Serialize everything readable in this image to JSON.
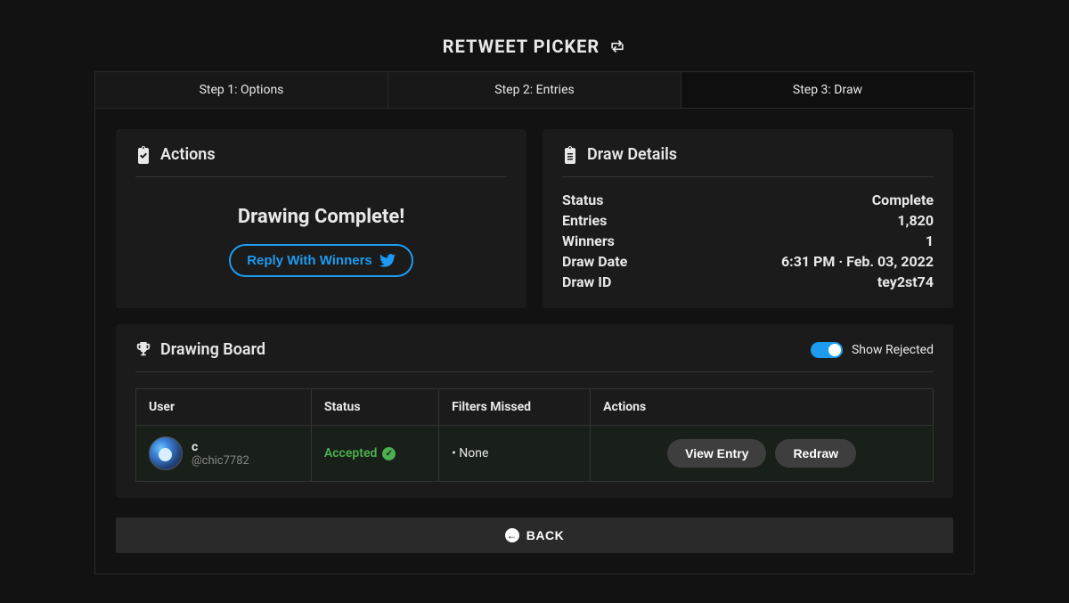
{
  "pageTitle": "RETWEET PICKER",
  "tabs": [
    {
      "label": "Step 1: Options"
    },
    {
      "label": "Step 2: Entries"
    },
    {
      "label": "Step 3: Draw"
    }
  ],
  "actions": {
    "title": "Actions",
    "completeText": "Drawing Complete!",
    "replyBtn": "Reply With Winners"
  },
  "details": {
    "title": "Draw Details",
    "rows": {
      "statusLabel": "Status",
      "statusValue": "Complete",
      "entriesLabel": "Entries",
      "entriesValue": "1,820",
      "winnersLabel": "Winners",
      "winnersValue": "1",
      "drawDateLabel": "Draw Date",
      "drawDateValue": "6:31 PM · Feb. 03, 2022",
      "drawIdLabel": "Draw ID",
      "drawIdValue": "tey2st74"
    }
  },
  "board": {
    "title": "Drawing Board",
    "toggleLabel": "Show Rejected",
    "columns": {
      "user": "User",
      "status": "Status",
      "filters": "Filters Missed",
      "actions": "Actions"
    },
    "row": {
      "displayName": "c",
      "handle": "@chic7782",
      "status": "Accepted",
      "filters": "• None",
      "viewEntry": "View Entry",
      "redraw": "Redraw"
    }
  },
  "backBtn": "BACK"
}
